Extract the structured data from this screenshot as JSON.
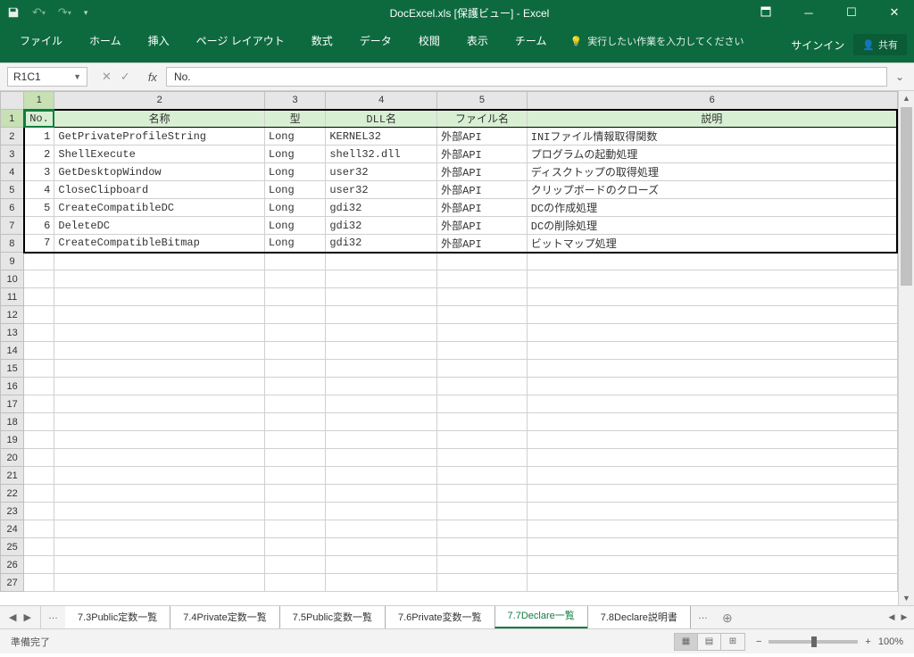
{
  "window": {
    "title": "DocExcel.xls  [保護ビュー] - Excel",
    "signin": "サインイン",
    "share": "共有"
  },
  "ribbon": {
    "tabs": [
      "ファイル",
      "ホーム",
      "挿入",
      "ページ レイアウト",
      "数式",
      "データ",
      "校閲",
      "表示",
      "チーム"
    ],
    "tellme": "実行したい作業を入力してください"
  },
  "namebox": "R1C1",
  "formula": "No.",
  "columns": {
    "widths": [
      26,
      34,
      234,
      68,
      124,
      100,
      412
    ],
    "numbers": [
      "",
      "1",
      "2",
      "3",
      "4",
      "5",
      "6"
    ]
  },
  "headers": [
    "No.",
    "名称",
    "型",
    "DLL名",
    "ファイル名",
    "説明"
  ],
  "rows": [
    {
      "no": "1",
      "name": "GetPrivateProfileString",
      "type": "Long",
      "dll": "KERNEL32",
      "file": "外部API",
      "desc": "INIファイル情報取得関数"
    },
    {
      "no": "2",
      "name": "ShellExecute",
      "type": "Long",
      "dll": "shell32.dll",
      "file": "外部API",
      "desc": "プログラムの起動処理"
    },
    {
      "no": "3",
      "name": "GetDesktopWindow",
      "type": "Long",
      "dll": "user32",
      "file": "外部API",
      "desc": "ディスクトップの取得処理"
    },
    {
      "no": "4",
      "name": "CloseClipboard",
      "type": "Long",
      "dll": "user32",
      "file": "外部API",
      "desc": "クリップボードのクローズ"
    },
    {
      "no": "5",
      "name": "CreateCompatibleDC",
      "type": "Long",
      "dll": "gdi32",
      "file": "外部API",
      "desc": "DCの作成処理"
    },
    {
      "no": "6",
      "name": "DeleteDC",
      "type": "Long",
      "dll": "gdi32",
      "file": "外部API",
      "desc": "DCの削除処理"
    },
    {
      "no": "7",
      "name": "CreateCompatibleBitmap",
      "type": "Long",
      "dll": "gdi32",
      "file": "外部API",
      "desc": "ビットマップ処理"
    }
  ],
  "blankrows": 19,
  "sheets": {
    "tabs": [
      "7.3Public定数一覧",
      "7.4Private定数一覧",
      "7.5Public変数一覧",
      "7.6Private変数一覧",
      "7.7Declare一覧",
      "7.8Declare説明書"
    ],
    "active": 4
  },
  "status": {
    "ready": "準備完了",
    "zoom": "100%"
  }
}
